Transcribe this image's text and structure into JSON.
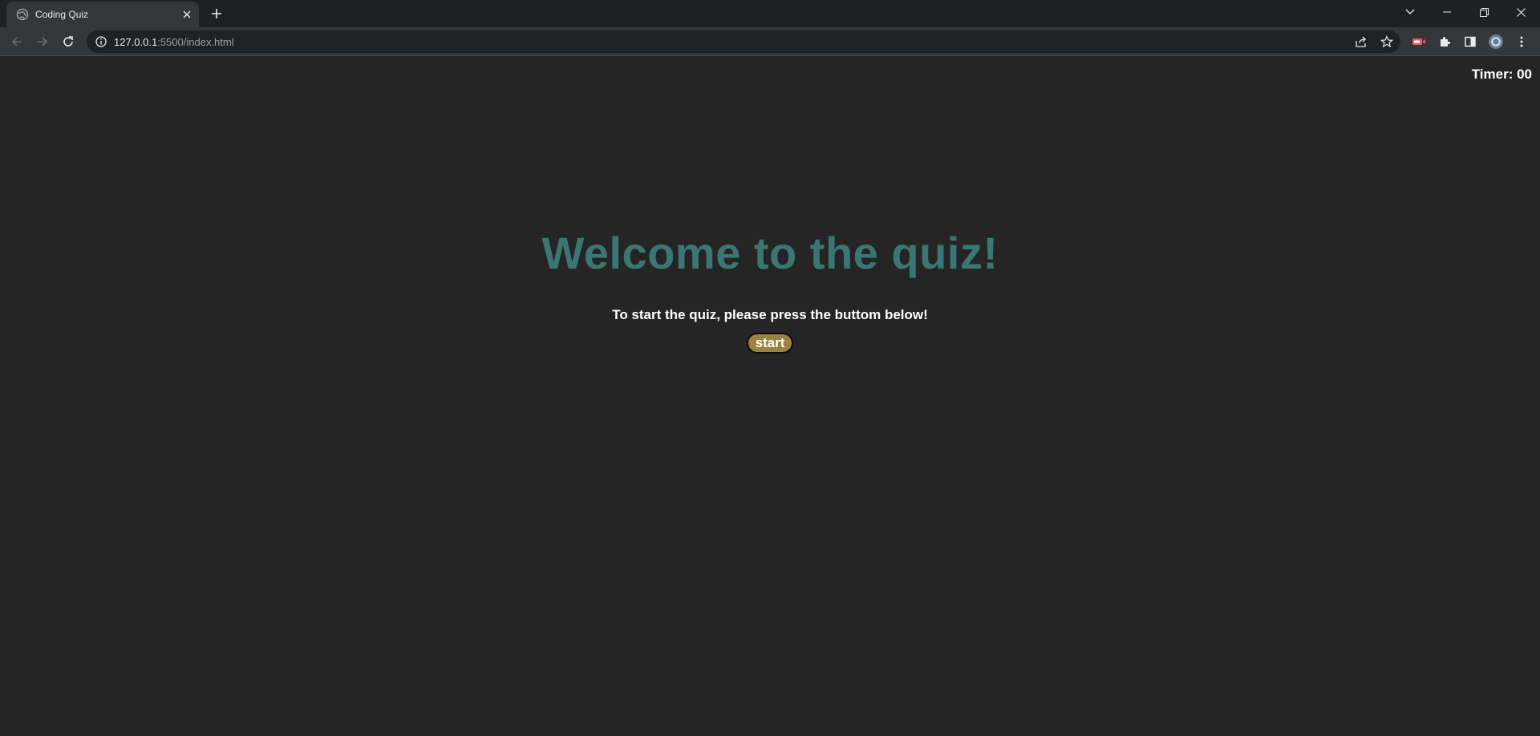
{
  "browser": {
    "tab": {
      "title": "Coding Quiz",
      "favicon": "globe-icon"
    },
    "address": {
      "host": "127.0.0.1",
      "path": ":5500/index.html"
    },
    "colors": {
      "titlebar": "#1f2023",
      "toolbar": "#35363a",
      "omnibox": "#202124"
    }
  },
  "page": {
    "timer": "Timer: 00",
    "heading": "Welcome to the quiz!",
    "instructions": "To start the quiz, please press the buttom below!",
    "start_label": "start",
    "colors": {
      "background": "#252525",
      "heading": "#3b7772",
      "button": "#9a8240"
    }
  }
}
